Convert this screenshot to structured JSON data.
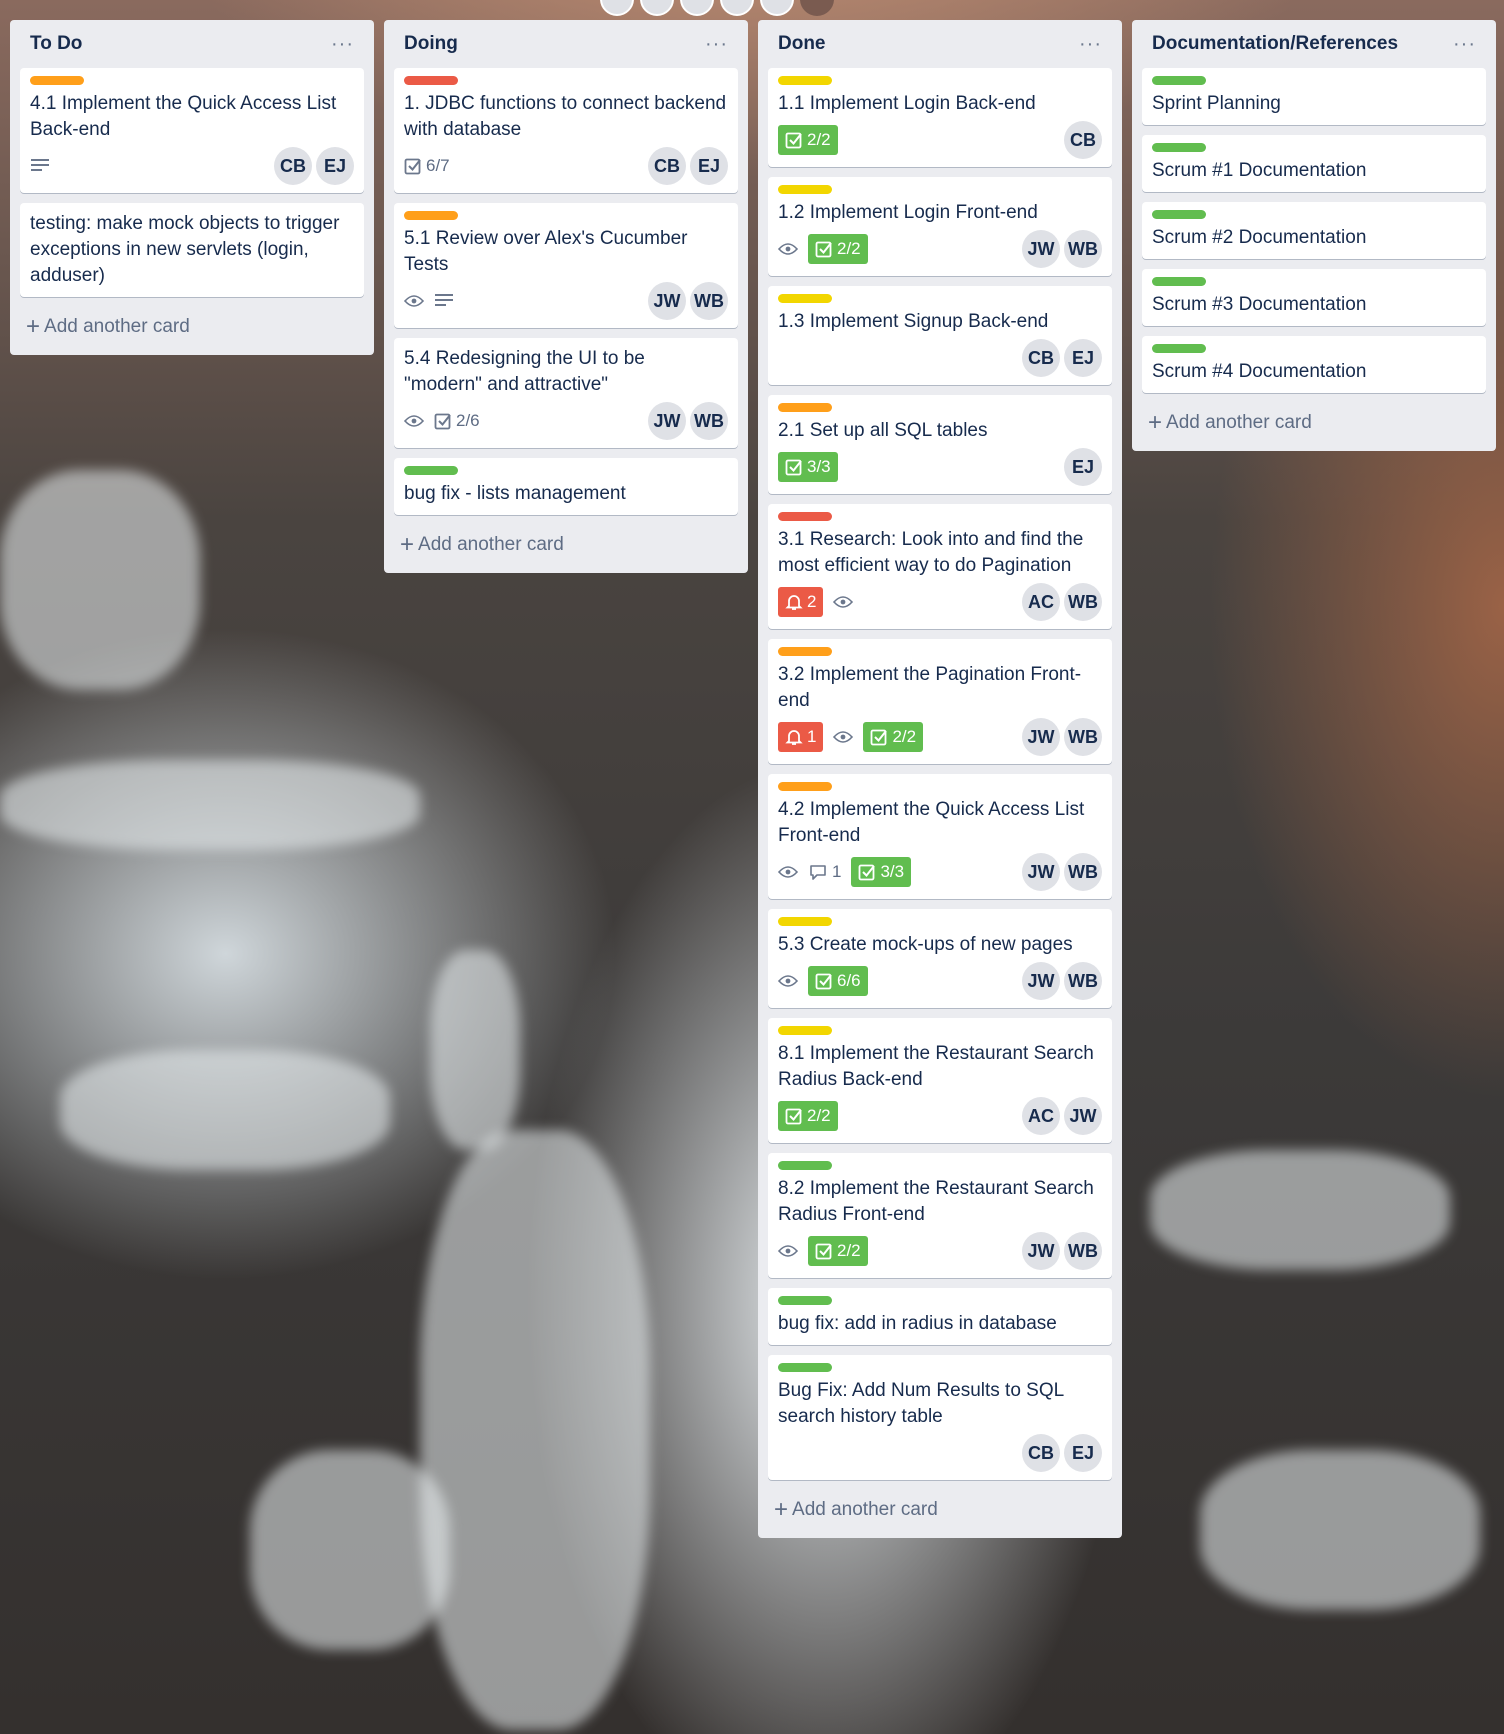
{
  "colors": {
    "orange": "#ff9f1a",
    "red": "#eb5a46",
    "yellow": "#f2d600",
    "green": "#61bd4f"
  },
  "add_label": "Add another card",
  "list_menu": "···",
  "lists": [
    {
      "title": "To Do",
      "cards": [
        {
          "label": "orange",
          "title": "4.1 Implement the Quick Access List Back-end",
          "desc": true,
          "members": [
            "CB",
            "EJ"
          ]
        },
        {
          "title": "testing: make mock objects to trigger exceptions in new servlets (login, adduser)"
        }
      ]
    },
    {
      "title": "Doing",
      "cards": [
        {
          "label": "red",
          "title": "1. JDBC functions to connect backend with database",
          "checklist": "6/7",
          "members": [
            "CB",
            "EJ"
          ]
        },
        {
          "label": "orange",
          "title": "5.1 Review over Alex's Cucumber Tests",
          "watch": true,
          "desc": true,
          "members": [
            "JW",
            "WB"
          ]
        },
        {
          "title": "5.4 Redesigning the UI to be \"modern\" and attractive\"",
          "watch": true,
          "checklist": "2/6",
          "members": [
            "JW",
            "WB"
          ]
        },
        {
          "label": "green",
          "title": "bug fix - lists management"
        }
      ]
    },
    {
      "title": "Done",
      "cards": [
        {
          "label": "yellow",
          "title": "1.1 Implement Login Back-end",
          "checklist_done": "2/2",
          "members": [
            "CB"
          ]
        },
        {
          "label": "yellow",
          "title": "1.2 Implement Login Front-end",
          "watch": true,
          "checklist_done": "2/2",
          "members": [
            "JW",
            "WB"
          ]
        },
        {
          "label": "yellow",
          "title": "1.3 Implement Signup Back-end",
          "members": [
            "CB",
            "EJ"
          ]
        },
        {
          "label": "orange",
          "title": "2.1 Set up all SQL tables",
          "checklist_done": "3/3",
          "members": [
            "EJ"
          ]
        },
        {
          "label": "red",
          "title": "3.1 Research: Look into and find the most efficient way to do Pagination",
          "due": "2",
          "watch": true,
          "members": [
            "AC",
            "WB"
          ]
        },
        {
          "label": "orange",
          "title": "3.2 Implement the Pagination Front-end",
          "due": "1",
          "watch": true,
          "checklist_done": "2/2",
          "members": [
            "JW",
            "WB"
          ]
        },
        {
          "label": "orange",
          "title": "4.2 Implement the Quick Access List Front-end",
          "watch": true,
          "comments": "1",
          "checklist_done": "3/3",
          "members": [
            "JW",
            "WB"
          ]
        },
        {
          "label": "yellow",
          "title": "5.3 Create mock-ups of new pages",
          "watch": true,
          "checklist_done": "6/6",
          "members": [
            "JW",
            "WB"
          ]
        },
        {
          "label": "yellow",
          "title": "8.1 Implement the Restaurant Search Radius Back-end",
          "checklist_done": "2/2",
          "members": [
            "AC",
            "JW"
          ]
        },
        {
          "label": "green",
          "title": "8.2 Implement the Restaurant Search Radius Front-end",
          "watch": true,
          "checklist_done": "2/2",
          "members": [
            "JW",
            "WB"
          ]
        },
        {
          "label": "green",
          "title": "bug fix: add in radius in database"
        },
        {
          "label": "green",
          "title": "Bug Fix: Add Num Results to SQL search history table",
          "members": [
            "CB",
            "EJ"
          ]
        }
      ]
    },
    {
      "title": "Documentation/References",
      "cards": [
        {
          "label": "green",
          "title": "Sprint Planning"
        },
        {
          "label": "green",
          "title": "Scrum #1 Documentation"
        },
        {
          "label": "green",
          "title": "Scrum #2 Documentation"
        },
        {
          "label": "green",
          "title": "Scrum #3 Documentation"
        },
        {
          "label": "green",
          "title": "Scrum #4 Documentation"
        }
      ]
    }
  ]
}
